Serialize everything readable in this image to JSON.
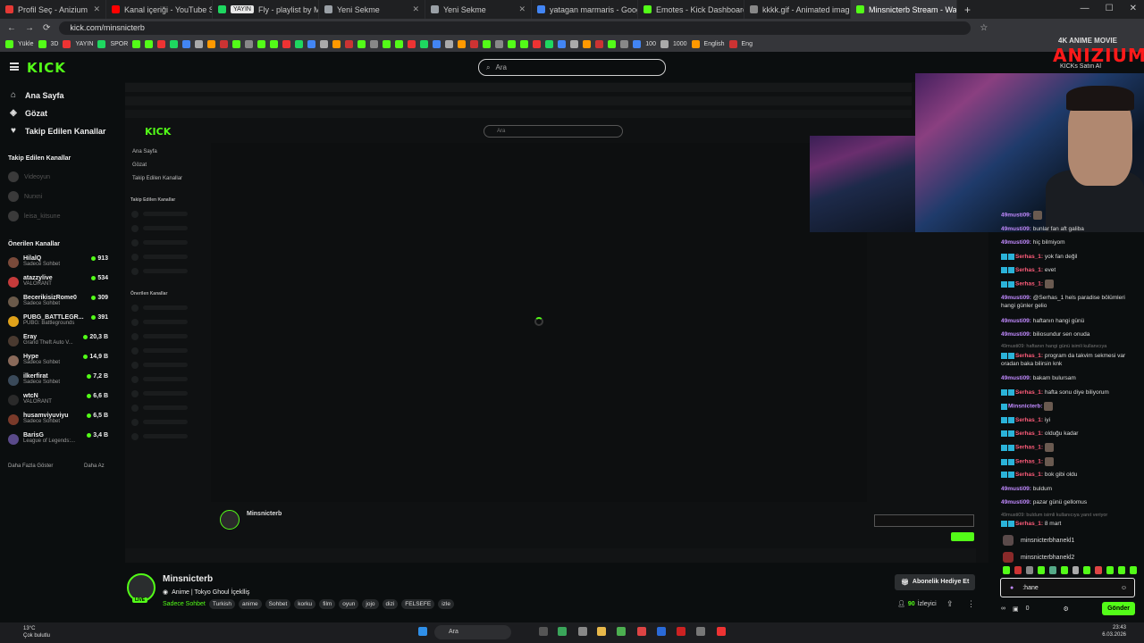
{
  "browser": {
    "tabs": [
      {
        "label": "Profil Seç - Anizium",
        "color": "#e53935"
      },
      {
        "label": "Kanal içeriği - YouTube Studio",
        "color": "#ff0000"
      },
      {
        "label": "Fly - playlist by Minsnicterb",
        "color": "#1ed760",
        "chip": "YAYIN"
      },
      {
        "label": "Yeni Sekme",
        "color": "#9aa0a6"
      },
      {
        "label": "Yeni Sekme",
        "color": "#9aa0a6"
      },
      {
        "label": "yatagan marmaris - Google'da",
        "color": "#4285f4"
      },
      {
        "label": "Emotes - Kick Dashboard",
        "color": "#53fc18"
      },
      {
        "label": "kkkk.gif - Animated image res...",
        "color": "#888888"
      },
      {
        "label": "Minsnicterb Stream - Watch Liv...",
        "color": "#53fc18",
        "active": true
      }
    ],
    "url": "kick.com/minsnicterb",
    "bookmark_labels": [
      "Yükle",
      "3D",
      "YAYIN",
      "SPOR",
      "100",
      "1000",
      "English",
      "Eng"
    ]
  },
  "kick": {
    "logo": "KICK",
    "search_placeholder": "Ara",
    "nav": [
      "Ana Sayfa",
      "Gözat",
      "Takip Edilen Kanallar"
    ],
    "followed_heading": "Takip Edilen Kanallar",
    "followed": [
      "Videoyun",
      "Nurxni",
      "leisa_kitsune"
    ],
    "recommended_heading": "Önerilen Kanallar",
    "recommended": [
      {
        "name": "HilalQ",
        "category": "Sadece Sohbet",
        "viewers": "913",
        "color": "#7a4a3a"
      },
      {
        "name": "atazzylive",
        "category": "VALORANT",
        "viewers": "534",
        "color": "#c53b3b"
      },
      {
        "name": "BecerikisizRome0",
        "category": "Sadece Sohbet",
        "viewers": "309",
        "color": "#6b5a4a"
      },
      {
        "name": "PUBG_BATTLEGR...",
        "category": "PUBG: Battlegrounds",
        "viewers": "391",
        "color": "#e0a21a"
      },
      {
        "name": "Eray",
        "category": "Grand Theft Auto V...",
        "viewers": "20,3 B",
        "color": "#4a3a30"
      },
      {
        "name": "Hype",
        "category": "Sadece Sohbet",
        "viewers": "14,9 B",
        "color": "#8a6a5a"
      },
      {
        "name": "ilkerfirat",
        "category": "Sadece Sohbet",
        "viewers": "7,2 B",
        "color": "#3a4a5a"
      },
      {
        "name": "wtcN",
        "category": "VALORANT",
        "viewers": "6,6 B",
        "color": "#2a2a2a"
      },
      {
        "name": "husamviyuviyu",
        "category": "Sadece Sohbet",
        "viewers": "6,5 B",
        "color": "#7a3a2a"
      },
      {
        "name": "BarisG",
        "category": "League of Legends:...",
        "viewers": "3,4 B",
        "color": "#5a4a8a"
      }
    ],
    "show_more": "Daha Fazla Göster",
    "show_less": "Daha Az"
  },
  "inner": {
    "nav": [
      "Ana Sayfa",
      "Gözat",
      "Takip Edilen Kanallar"
    ],
    "followed_heading": "Takip Edilen Kanallar",
    "recommended_heading": "Önerilen Kanallar",
    "streamer": "Minsnicterb"
  },
  "overlay": {
    "brand_top": "4K ANIME MOVIE",
    "brand_main": "ANIZIUM",
    "kicks": "KICKs Satın Al"
  },
  "chat": {
    "messages": [
      {
        "user": "49musti09:",
        "kind": "u",
        "text": "",
        "mini": true
      },
      {
        "user": "49musti09:",
        "kind": "u",
        "text": "bunlar fan aft galiba"
      },
      {
        "user": "49musti09:",
        "kind": "u",
        "text": "hiç bilmiyom"
      },
      {
        "user": "Serhas_1:",
        "kind": "r",
        "badges": 2,
        "text": "yok fan değil"
      },
      {
        "user": "Serhas_1:",
        "kind": "r",
        "badges": 2,
        "text": "evet"
      },
      {
        "user": "Serhas_1:",
        "kind": "r",
        "badges": 2,
        "text": "",
        "mini": true
      },
      {
        "user": "49musti09:",
        "kind": "u",
        "text": "@Serhas_1 hels paradise bölümleri hangi günler gelio"
      },
      {
        "user": "49musti09:",
        "kind": "u",
        "text": "haftanın hangi günü"
      },
      {
        "user": "49musti09:",
        "kind": "u",
        "text": "biliosundur sen onuda"
      },
      {
        "user": "",
        "kind": "dim",
        "text": "49musti09: haftanın hangi günü isimli kullanıcıya"
      },
      {
        "user": "Serhas_1:",
        "kind": "r",
        "badges": 2,
        "text": "program da takvim sekmesi var oradan baka bilirsin knk"
      },
      {
        "user": "49musti09:",
        "kind": "u",
        "text": "bakam bulursam"
      },
      {
        "user": "Serhas_1:",
        "kind": "r",
        "badges": 2,
        "text": "hafta sonu diye biliyorum"
      },
      {
        "user": "Minsnicterb:",
        "kind": "u",
        "badges": 1,
        "text": "",
        "mini": true
      },
      {
        "user": "Serhas_1:",
        "kind": "r",
        "badges": 2,
        "text": "iyi"
      },
      {
        "user": "Serhas_1:",
        "kind": "r",
        "badges": 2,
        "text": "olduğu kadar"
      },
      {
        "user": "Serhas_1:",
        "kind": "r",
        "badges": 2,
        "text": "",
        "mini": true
      },
      {
        "user": "Serhas_1:",
        "kind": "r",
        "badges": 2,
        "text": "",
        "mini": true
      },
      {
        "user": "Serhas_1:",
        "kind": "r",
        "badges": 2,
        "text": "bok gibi oldu"
      },
      {
        "user": "49musti09:",
        "kind": "u",
        "text": "buldum"
      },
      {
        "user": "49musti09:",
        "kind": "u",
        "text": "pazar günü gellomus"
      },
      {
        "user": "",
        "kind": "dim",
        "text": "49musti09: buldum isimli kullanıcıya yanıt veriyor"
      },
      {
        "user": "Serhas_1:",
        "kind": "r",
        "badges": 2,
        "text": "8 mart"
      }
    ],
    "suggestions": [
      "minsnicterbhanekl1",
      "minsnicterbhanekl2"
    ],
    "input_value": ":hane",
    "points": "0",
    "send_label": "Gönder"
  },
  "stream": {
    "streamer": "Minsnicterb",
    "title": "Anime | Tokyo Ghoul İçeklliş",
    "category": "Sadece Sohbet",
    "tags": [
      "Turkish",
      "anime",
      "Sohbet",
      "korku",
      "film",
      "oyun",
      "jojo",
      "dizi",
      "FELSEFE",
      "izle"
    ],
    "live": "LIVE",
    "subscribe_gift": "Abonelik Hediye Et",
    "viewers": "90",
    "viewers_label": "İzleyici"
  },
  "taskbar": {
    "temp": "13°C",
    "weather": "Çok bulutlu",
    "search": "Ara",
    "time": "23:43",
    "date": "6.03.2026"
  }
}
